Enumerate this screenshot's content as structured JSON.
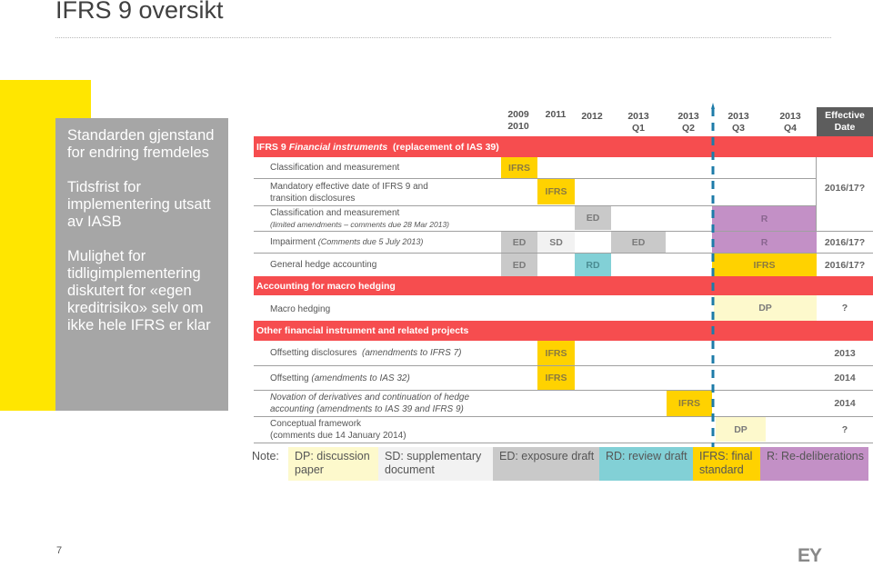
{
  "title": "IFRS 9 oversikt",
  "side_panel": {
    "points": [
      "Standarden gjenstand for endring fremdeles",
      "Tidsfrist for implementering utsatt av IASB",
      "Mulighet for tidligimplementering diskutert for «egen kreditrisiko» selv om ikke hele IFRS er klar"
    ]
  },
  "timeline": {
    "columns": [
      {
        "line1": "2009",
        "line2": "2010"
      },
      {
        "line1": "2011",
        "line2": ""
      },
      {
        "line1": "2012",
        "line2": ""
      },
      {
        "line1": "2013",
        "line2": "Q1"
      },
      {
        "line1": "2013",
        "line2": "Q2"
      },
      {
        "line1": "2013",
        "line2": "Q3"
      },
      {
        "line1": "2013",
        "line2": "Q4"
      }
    ],
    "effective_date_header": {
      "line1": "Effective",
      "line2": "Date"
    },
    "sections": [
      {
        "title_plain": "IFRS 9 ",
        "title_italic": "Financial instruments",
        "title_suffix": "  (replacement of IAS 39)",
        "rows": [
          {
            "label": "Classification and measurement",
            "note": "",
            "effective": ""
          },
          {
            "label": "Mandatory effective date of IFRS 9 and transition disclosures",
            "note": "",
            "effective": "2016/17?"
          },
          {
            "label": "Classification and measurement",
            "note": "(limited amendments – comments due 28 Mar 2013)",
            "effective": ""
          },
          {
            "label": "Impairment ",
            "note": "(Comments due 5 July 2013)",
            "effective": "2016/17?"
          },
          {
            "label": "General hedge accounting",
            "note": "",
            "effective": "2016/17?"
          }
        ]
      },
      {
        "title_plain": "Accounting for macro hedging",
        "rows": [
          {
            "label": "Macro hedging",
            "note": "",
            "effective": "?"
          }
        ]
      },
      {
        "title_plain": "Other financial instrument and related projects",
        "rows": [
          {
            "label": "Offsetting disclosures  ",
            "note": "(amendments to IFRS 7)",
            "effective": "2013"
          },
          {
            "label": "Offsetting ",
            "note": "(amendments to IAS 32)",
            "effective": "2014"
          },
          {
            "label": "",
            "note": "Novation of derivatives and continuation of hedge accounting (amendments to IAS 39 and IFRS 9)",
            "effective": "2014"
          },
          {
            "label": "Conceptual framework",
            "note": "(comments due 14 January 2014)",
            "effective": "?"
          }
        ]
      }
    ],
    "milestones": {
      "cm_ifrs": "IFRS",
      "mandatory_ifrs": "IFRS",
      "cm_limited_ed": "ED",
      "cm_limited_r": "R",
      "impairment_ed1": "ED",
      "impairment_sd": "SD",
      "impairment_ed2": "ED",
      "impairment_r": "R",
      "hedge_ed": "ED",
      "hedge_rd": "RD",
      "hedge_ifrs": "IFRS",
      "macro_dp": "DP",
      "offset_disc_ifrs": "IFRS",
      "offset_ifrs": "IFRS",
      "novation_ifrs": "IFRS",
      "conceptual_dp": "DP"
    },
    "current_date_marker": "between 2013 Q2 and 2013 Q3"
  },
  "legend": {
    "note_label": "Note:",
    "items": [
      {
        "key": "dp",
        "text": "DP: discussion paper",
        "color": "#fdf9cc"
      },
      {
        "key": "sd",
        "text": "SD: supplementary document",
        "color": "#f2f2f2"
      },
      {
        "key": "ed",
        "text": "ED: exposure draft",
        "color": "#c9c9c9"
      },
      {
        "key": "rd",
        "text": "RD: review draft",
        "color": "#82d0d6"
      },
      {
        "key": "ifrs",
        "text": "IFRS: final standard",
        "color": "#ffd200"
      },
      {
        "key": "r",
        "text": "R: Re-deliberations",
        "color": "#c390c6"
      }
    ]
  },
  "colors": {
    "section_bar": "#f64d4f",
    "brand_yellow": "#ffe600",
    "panel_gray": "#a6a6a6",
    "today_marker": "#1d7ba8"
  },
  "footer": {
    "page_number": "7",
    "logo": "EY"
  }
}
